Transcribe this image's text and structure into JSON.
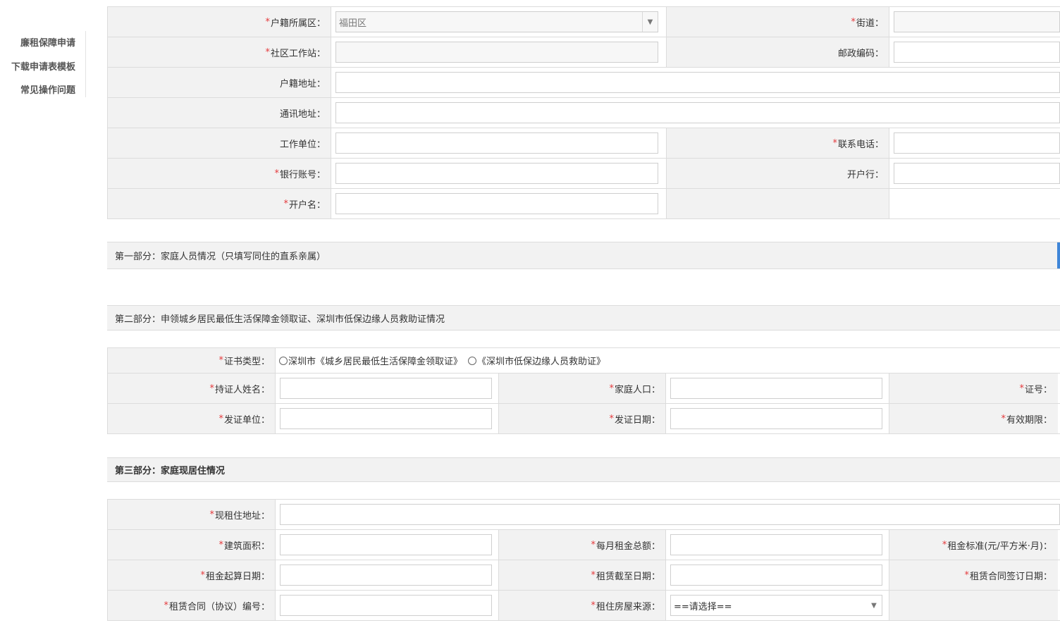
{
  "sidebar": {
    "items": [
      "廉租保障申请",
      "下载申请表模板",
      "常见操作问题"
    ]
  },
  "form_top": {
    "huji_district": {
      "label": "户籍所属区：",
      "value": "福田区"
    },
    "street": {
      "label": "街道："
    },
    "community": {
      "label": "社区工作站："
    },
    "postcode": {
      "label": "邮政编码："
    },
    "huji_address": {
      "label": "户籍地址："
    },
    "mail_address": {
      "label": "通讯地址："
    },
    "employer": {
      "label": "工作单位："
    },
    "phone": {
      "label": "联系电话："
    },
    "bank_account": {
      "label": "银行账号："
    },
    "bank_branch": {
      "label": "开户行："
    },
    "account_name": {
      "label": "开户名："
    }
  },
  "sections": {
    "part1": "第一部分：家庭人员情况（只填写同住的直系亲属）",
    "part2": "第二部分：申领城乡居民最低生活保障金领取证、深圳市低保边缘人员救助证情况",
    "part3": "第三部分：家庭现居住情况"
  },
  "part2": {
    "cert_type": {
      "label": "证书类型：",
      "options": [
        "深圳市《城乡居民最低生活保障金领取证》",
        "《深圳市低保边缘人员救助证》"
      ]
    },
    "holder_name": {
      "label": "持证人姓名："
    },
    "family_count": {
      "label": "家庭人口："
    },
    "cert_no": {
      "label": "证号："
    },
    "issuer": {
      "label": "发证单位："
    },
    "issue_date": {
      "label": "发证日期："
    },
    "valid_period": {
      "label": "有效期限："
    }
  },
  "part3": {
    "current_address": {
      "label": "现租住地址："
    },
    "floor_area": {
      "label": "建筑面积："
    },
    "monthly_rent": {
      "label": "每月租金总额："
    },
    "rent_standard": {
      "label": "租金标准(元/平方米·月)："
    },
    "rent_start": {
      "label": "租金起算日期："
    },
    "lease_end": {
      "label": "租赁截至日期："
    },
    "contract_sign_date": {
      "label": "租赁合同签订日期："
    },
    "contract_no": {
      "label": "租赁合同（协议）编号："
    },
    "house_source": {
      "label": "租住房屋来源：",
      "value": "==请选择=="
    }
  },
  "colors": {
    "required": "#e4393c",
    "label_bg": "#f2f2f2",
    "border": "#dcdcdc",
    "accent": "#3f86d8"
  }
}
